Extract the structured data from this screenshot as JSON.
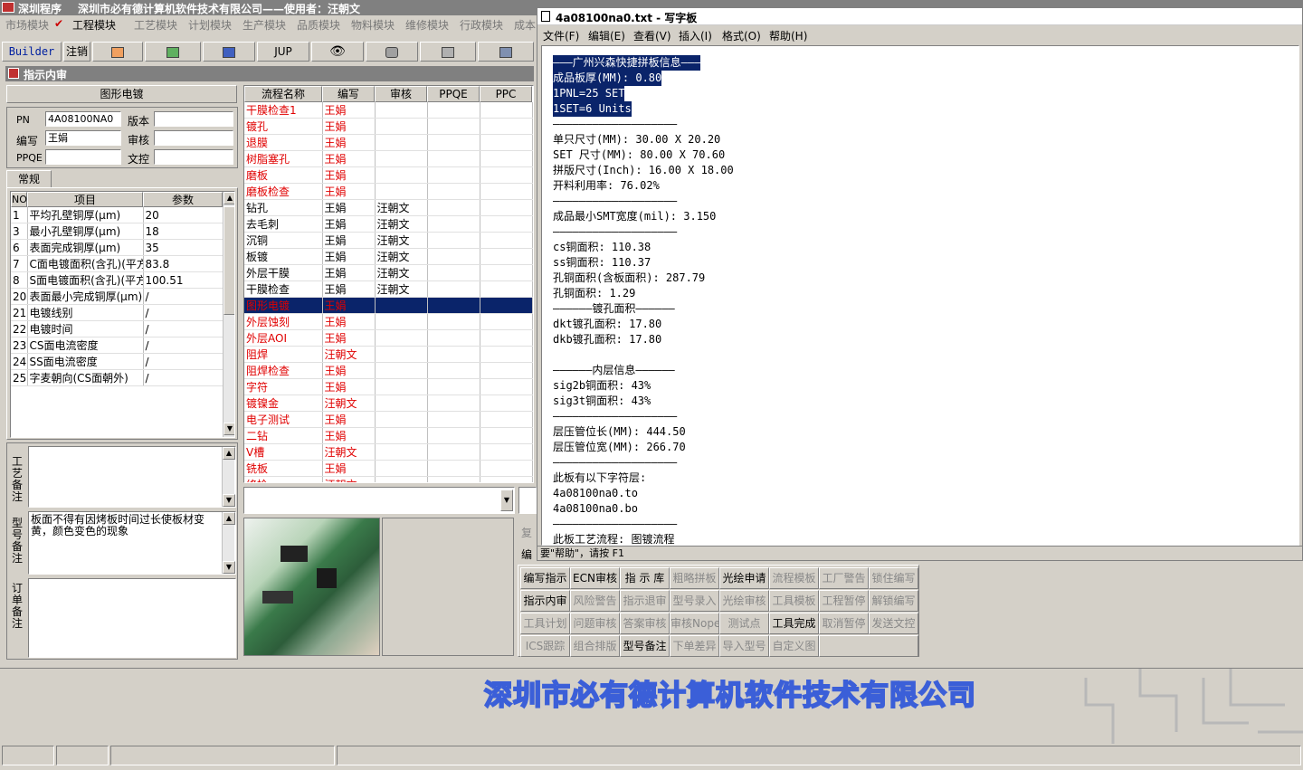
{
  "app": {
    "title": "深圳程序",
    "company_user": "深圳市必有德计算机软件技术有限公司——使用者：汪朝文"
  },
  "menu": {
    "items": [
      "市场模块",
      "工程模块",
      "工艺模块",
      "计划模块",
      "生产模块",
      "品质模块",
      "物料模块",
      "维修模块",
      "行政模块",
      "成本"
    ],
    "checked": "工程模块"
  },
  "toolbar": {
    "builder": "Builder",
    "zhuxiao": "注销",
    "jup": "JUP"
  },
  "panel": {
    "title": "指示内审"
  },
  "form": {
    "section_title": "图形电镀",
    "pn_label": "PN",
    "pn_value": "4A08100NA0",
    "version_label": "版本",
    "version_value": "",
    "editor_label": "编写",
    "editor_value": "王娟",
    "review_label": "审核",
    "review_value": "",
    "ppqe_label": "PPQE",
    "ppqe_value": "",
    "doc_label": "文控",
    "doc_value": ""
  },
  "tabs": {
    "normal": "常规"
  },
  "param_table": {
    "headers": [
      "NO",
      "项目",
      "参数"
    ],
    "rows": [
      {
        "no": "1",
        "item": "平均孔壁铜厚(μm)",
        "param": "20"
      },
      {
        "no": "3",
        "item": "最小孔壁铜厚(μm)",
        "param": "18"
      },
      {
        "no": "6",
        "item": "表面完成铜厚(μm)",
        "param": "35"
      },
      {
        "no": "7",
        "item": "C面电镀面积(含孔)(平方",
        "param": "83.8"
      },
      {
        "no": "8",
        "item": "S面电镀面积(含孔)(平方",
        "param": "100.51"
      },
      {
        "no": "20",
        "item": "表面最小完成铜厚(μm)",
        "param": "/"
      },
      {
        "no": "21",
        "item": "电镀线别",
        "param": "/"
      },
      {
        "no": "22",
        "item": "电镀时间",
        "param": "/"
      },
      {
        "no": "23",
        "item": "CS面电流密度",
        "param": "/"
      },
      {
        "no": "24",
        "item": "SS面电流密度",
        "param": "/"
      },
      {
        "no": "25",
        "item": "字麦朝向(CS面朝外)",
        "param": "/"
      }
    ]
  },
  "notes": {
    "process_label": "工艺备注",
    "process_text": "",
    "model_label": "型号备注",
    "model_text": "板面不得有因烤板时间过长使板材变黄，颜色变色的现象",
    "order_label": "订单备注",
    "order_text": ""
  },
  "flow_table": {
    "headers": [
      "流程名称",
      "编写",
      "审核",
      "PPQE",
      "PPC"
    ],
    "rows": [
      {
        "name": "干膜检查1",
        "editor": "王娟",
        "reviewer": "",
        "red": true
      },
      {
        "name": "镀孔",
        "editor": "王娟",
        "reviewer": "",
        "red": true
      },
      {
        "name": "退膜",
        "editor": "王娟",
        "reviewer": "",
        "red": true
      },
      {
        "name": "树脂塞孔",
        "editor": "王娟",
        "reviewer": "",
        "red": true
      },
      {
        "name": "磨板",
        "editor": "王娟",
        "reviewer": "",
        "red": true
      },
      {
        "name": "磨板检查",
        "editor": "王娟",
        "reviewer": "",
        "red": true
      },
      {
        "name": "钻孔",
        "editor": "王娟",
        "reviewer": "汪朝文",
        "red": false
      },
      {
        "name": "去毛刺",
        "editor": "王娟",
        "reviewer": "汪朝文",
        "red": false
      },
      {
        "name": "沉铜",
        "editor": "王娟",
        "reviewer": "汪朝文",
        "red": false
      },
      {
        "name": "板镀",
        "editor": "王娟",
        "reviewer": "汪朝文",
        "red": false
      },
      {
        "name": "外层干膜",
        "editor": "王娟",
        "reviewer": "汪朝文",
        "red": false
      },
      {
        "name": "干膜检查",
        "editor": "王娟",
        "reviewer": "汪朝文",
        "red": false
      },
      {
        "name": "图形电镀",
        "editor": "王娟",
        "reviewer": "",
        "red": true,
        "selected": true
      },
      {
        "name": "外层蚀刻",
        "editor": "王娟",
        "reviewer": "",
        "red": true
      },
      {
        "name": "外层AOI",
        "editor": "王娟",
        "reviewer": "",
        "red": true
      },
      {
        "name": "阻焊",
        "editor": "汪朝文",
        "reviewer": "",
        "red": true
      },
      {
        "name": "阻焊检查",
        "editor": "王娟",
        "reviewer": "",
        "red": true
      },
      {
        "name": "字符",
        "editor": "王娟",
        "reviewer": "",
        "red": true
      },
      {
        "name": "镀镍金",
        "editor": "汪朝文",
        "reviewer": "",
        "red": true
      },
      {
        "name": "电子测试",
        "editor": "王娟",
        "reviewer": "",
        "red": true
      },
      {
        "name": "二钻",
        "editor": "王娟",
        "reviewer": "",
        "red": true
      },
      {
        "name": "V槽",
        "editor": "汪朝文",
        "reviewer": "",
        "red": true
      },
      {
        "name": "铣板",
        "editor": "王娟",
        "reviewer": "",
        "red": true
      },
      {
        "name": "终检",
        "editor": "汪朝文",
        "reviewer": "",
        "red": true
      }
    ]
  },
  "notepad": {
    "title": "4a08100na0.txt - 写字板",
    "menu": [
      "文件(F)",
      "编辑(E)",
      "查看(V)",
      "插入(I)",
      "格式(O)",
      "帮助(H)"
    ],
    "lines": [
      "———广州兴森快捷拼板信息———",
      "成品板厚(MM): 0.80",
      "1PNL=25 SET",
      "1SET=6 Units",
      "———————————————————",
      "单只尺寸(MM): 30.00 X 20.20",
      "SET 尺寸(MM): 80.00 X 70.60",
      "拼版尺寸(Inch): 16.00 X 18.00",
      "开料利用率: 76.02%",
      "———————————————————",
      "成品最小SMT宽度(mil): 3.150",
      "———————————————————",
      "cs铜面积: 110.38",
      "ss铜面积: 110.37",
      "孔铜面积(含板面积): 287.79",
      "孔铜面积: 1.29",
      "——————镀孔面积——————",
      "dkt镀孔面积: 17.80",
      "dkb镀孔面积: 17.80",
      "",
      "——————内层信息——————",
      "sig2b铜面积: 43%",
      "sig3t铜面积: 43%",
      "———————————————————",
      "层压管位长(MM): 444.50",
      "层压管位宽(MM): 266.70",
      "———————————————————",
      "此板有以下字符层:",
      "4a08100na0.to",
      "4a08100na0.bo",
      "———————————————————",
      "此板工艺流程: 图镀流程"
    ],
    "status": "要\"帮助\"，请按 F1"
  },
  "peek": {
    "fu": "复",
    "bian": "编"
  },
  "buttons": [
    [
      "编写指示",
      "ECN审核",
      "指 示 库",
      "粗略拼板",
      "光绘申请",
      "流程模板",
      "工厂警告",
      "锁住编写"
    ],
    [
      "指示内审",
      "风险警告",
      "指示退审",
      "型号录入",
      "光绘审核",
      "工具模板",
      "工程暂停",
      "解锁编写"
    ],
    [
      "工具计划",
      "问题审核",
      "答案审核",
      "审核Nope",
      "测试点",
      "工具完成",
      "取消暂停",
      "发送文控"
    ],
    [
      "ICS跟踪",
      "组合排版",
      "型号备注",
      "下单差异",
      "导入型号",
      "自定义图",
      ""
    ]
  ],
  "buttons_disabled": [
    [
      false,
      false,
      false,
      true,
      false,
      true,
      true,
      true
    ],
    [
      false,
      true,
      true,
      true,
      true,
      true,
      true,
      true
    ],
    [
      true,
      true,
      true,
      true,
      true,
      false,
      true,
      true
    ],
    [
      true,
      true,
      false,
      true,
      true,
      true,
      true
    ]
  ],
  "footer": {
    "company_banner": "深圳市必有德计算机软件技术有限公司"
  },
  "colors": {
    "selection": "#0a246a",
    "red_text": "#e00000",
    "banner": "#3b5fd8"
  }
}
